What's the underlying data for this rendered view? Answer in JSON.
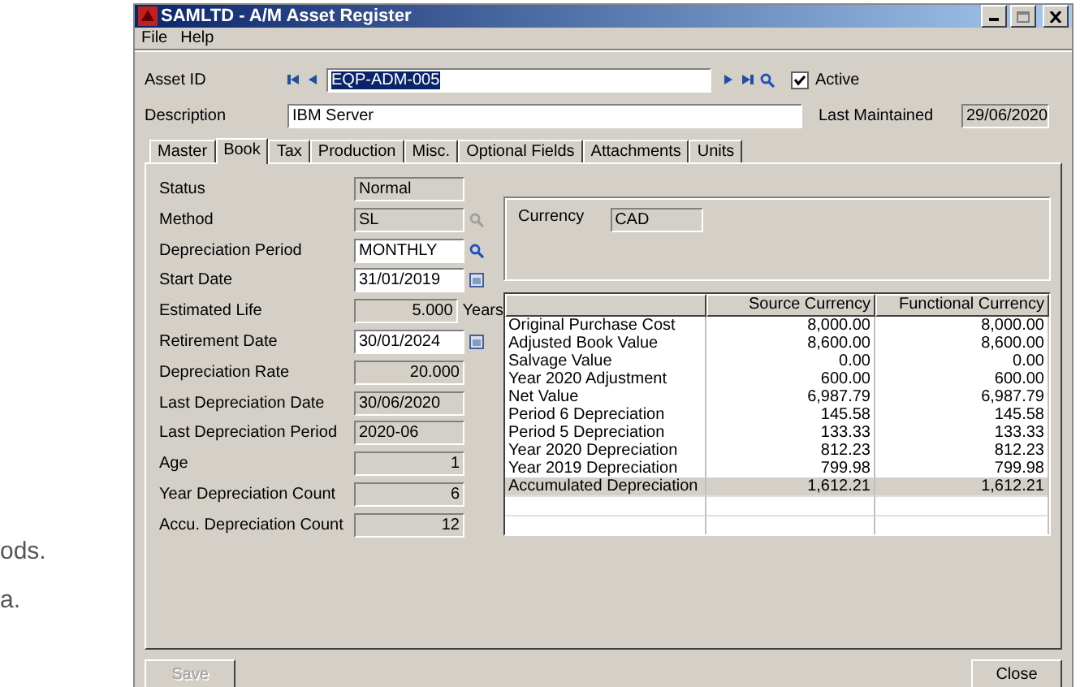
{
  "page_text": [
    "ods.",
    "a."
  ],
  "window": {
    "title": "SAMLTD - A/M Asset Register"
  },
  "menu": [
    "File",
    "Help"
  ],
  "asset_id": {
    "label": "Asset ID",
    "value": "EQP-ADM-005"
  },
  "active": {
    "label": "Active",
    "checked": true
  },
  "description": {
    "label": "Description",
    "value": "IBM Server"
  },
  "last_maintained": {
    "label": "Last Maintained",
    "value": "29/06/2020"
  },
  "tabs": [
    {
      "label": "Master",
      "selected": false
    },
    {
      "label": "Book",
      "selected": true
    },
    {
      "label": "Tax",
      "selected": false
    },
    {
      "label": "Production",
      "selected": false
    },
    {
      "label": "Misc.",
      "selected": false
    },
    {
      "label": "Optional Fields",
      "selected": false
    },
    {
      "label": "Attachments",
      "selected": false
    },
    {
      "label": "Units",
      "selected": false
    }
  ],
  "fields": [
    {
      "label": "Status",
      "value": "Normal",
      "editable": false,
      "numeric": false
    },
    {
      "label": "Method",
      "value": "SL",
      "editable": false,
      "numeric": false,
      "kind": "lookup",
      "button_disabled": true
    },
    {
      "label": "Depreciation Period",
      "value": "MONTHLY",
      "editable": true,
      "numeric": false,
      "kind": "lookup",
      "button_disabled": false
    },
    {
      "label": "Start Date",
      "value": "31/01/2019",
      "editable": true,
      "numeric": false,
      "kind": "calendar",
      "button_disabled": false
    },
    {
      "label": "Estimated Life",
      "value": "5.000",
      "editable": false,
      "numeric": true,
      "suffix": "Years"
    },
    {
      "label": "Retirement Date",
      "value": "30/01/2024",
      "editable": true,
      "numeric": false,
      "kind": "calendar",
      "button_disabled": false
    },
    {
      "label": "Depreciation Rate",
      "value": "20.000",
      "editable": false,
      "numeric": true
    },
    {
      "label": "Last Depreciation Date",
      "value": "30/06/2020",
      "editable": false,
      "numeric": false
    },
    {
      "label": "Last Depreciation Period",
      "value": "2020-06",
      "editable": false,
      "numeric": false
    },
    {
      "label": "Age",
      "value": "1",
      "editable": false,
      "numeric": true
    },
    {
      "label": "Year Depreciation Count",
      "value": "6",
      "editable": false,
      "numeric": true
    },
    {
      "label": "Accu. Depreciation Count",
      "value": "12",
      "editable": false,
      "numeric": true
    }
  ],
  "currency": {
    "label": "Currency",
    "value": "CAD"
  },
  "table": {
    "columns": [
      "",
      "Source Currency",
      "Functional Currency"
    ],
    "rows": [
      {
        "cells": [
          "Original Purchase Cost",
          "8,000.00",
          "8,000.00"
        ],
        "selected": false
      },
      {
        "cells": [
          "Adjusted Book Value",
          "8,600.00",
          "8,600.00"
        ],
        "selected": false
      },
      {
        "cells": [
          "Salvage Value",
          "0.00",
          "0.00"
        ],
        "selected": false
      },
      {
        "cells": [
          "Year 2020 Adjustment",
          "600.00",
          "600.00"
        ],
        "selected": false
      },
      {
        "cells": [
          "Net Value",
          "6,987.79",
          "6,987.79"
        ],
        "selected": false
      },
      {
        "cells": [
          "Period 6 Depreciation",
          "145.58",
          "145.58"
        ],
        "selected": false
      },
      {
        "cells": [
          "Period 5 Depreciation",
          "133.33",
          "133.33"
        ],
        "selected": false
      },
      {
        "cells": [
          "Year 2020 Depreciation",
          "812.23",
          "812.23"
        ],
        "selected": false
      },
      {
        "cells": [
          "Year 2019 Depreciation",
          "799.98",
          "799.98"
        ],
        "selected": false
      },
      {
        "cells": [
          "Accumulated Depreciation",
          "1,612.21",
          "1,612.21"
        ],
        "selected": true
      }
    ]
  },
  "buttons": [
    {
      "label": "Save",
      "disabled": true
    },
    {
      "label": "Close",
      "disabled": false
    }
  ]
}
